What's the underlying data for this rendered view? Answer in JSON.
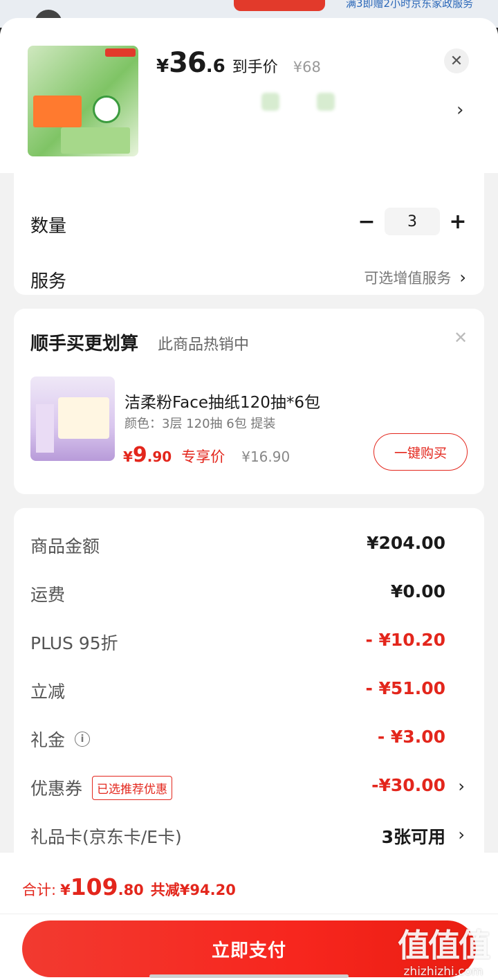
{
  "background": {
    "text": "满3即赠2小时京东家政服务"
  },
  "product": {
    "currency": "¥",
    "price_int": "36",
    "price_dec": ".6",
    "price_tag": "到手价",
    "original_price": "¥68"
  },
  "quantity": {
    "label": "数量",
    "minus": "−",
    "value": "3",
    "plus": "+"
  },
  "service": {
    "label": "服务",
    "link_text": "可选增值服务"
  },
  "addon": {
    "title": "顺手买更划算",
    "subtitle": "此商品热销中",
    "name": "洁柔粉Face抽纸120抽*6包",
    "spec": "颜色：3层 120抽 6包 提装",
    "currency": "¥",
    "price_int": "9",
    "price_dec": ".90",
    "price_tag": "专享价",
    "original_price": "¥16.90",
    "buy_button": "一键购买"
  },
  "summary": {
    "rows": [
      {
        "label": "商品金额",
        "value": "¥204.00"
      },
      {
        "label": "运费",
        "value": "¥0.00"
      },
      {
        "label": "PLUS 95折",
        "value": "- ¥10.20"
      },
      {
        "label": "立减",
        "value": "- ¥51.00"
      },
      {
        "label": "礼金",
        "value": "- ¥3.00"
      },
      {
        "label": "优惠券",
        "badge": "已选推荐优惠",
        "value": "-¥30.00"
      },
      {
        "label": "礼品卡(京东卡/E卡)",
        "value": "3张可用"
      }
    ]
  },
  "footer": {
    "total_label": "合计:",
    "currency": "¥",
    "total_int": "109",
    "total_dec": ".80",
    "savings": "共减¥94.20",
    "pay_button": "立即支付"
  },
  "watermark": {
    "big": "值值值",
    "small": "zhizhizhi.com"
  },
  "colors": {
    "accent_red": "#e3261c",
    "text_dark": "#1a1a1a",
    "text_gray": "#777777"
  }
}
